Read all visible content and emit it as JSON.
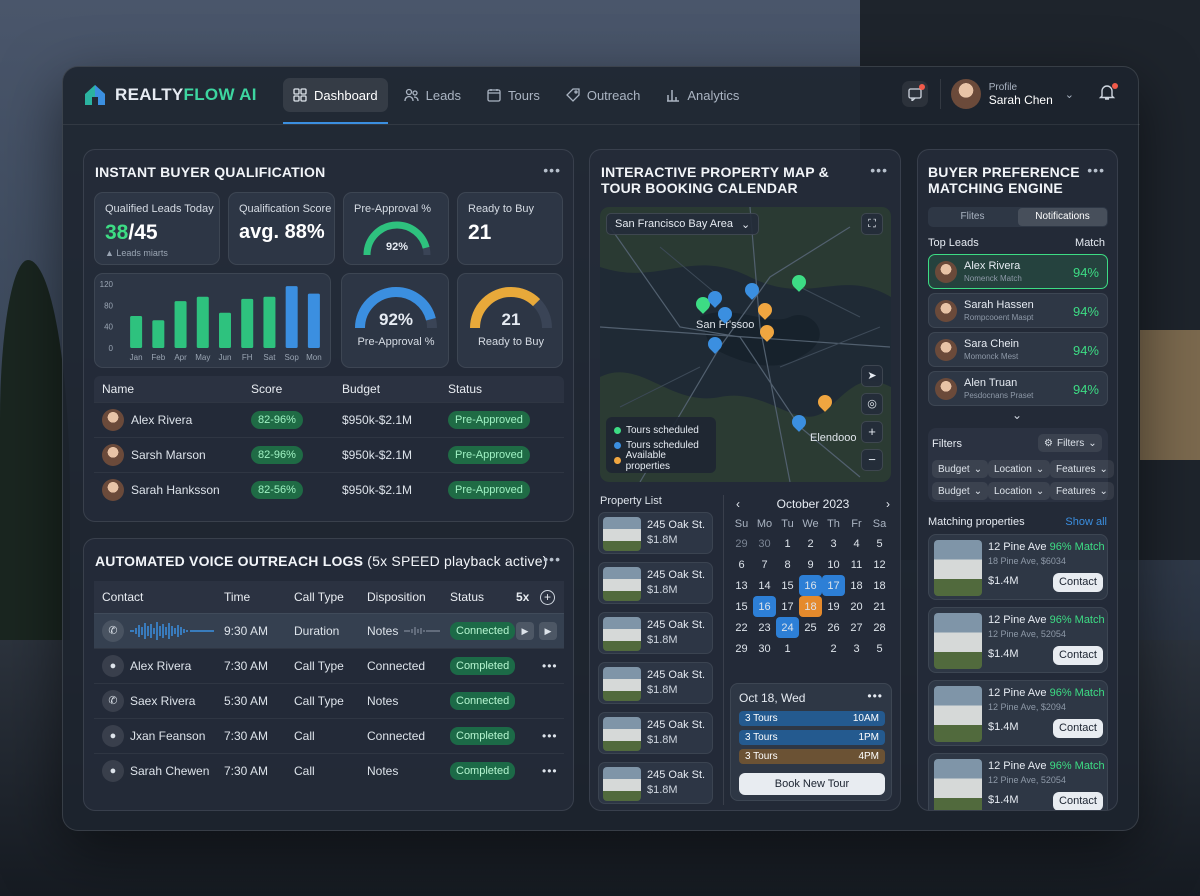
{
  "app": {
    "brand_a": "REALTY",
    "brand_b": "FLOW AI",
    "accent": "#3ddc84"
  },
  "nav": [
    {
      "label": "Dashboard",
      "icon": "grid-icon"
    },
    {
      "label": "Leads",
      "icon": "users-icon"
    },
    {
      "label": "Tours",
      "icon": "calendar-icon"
    },
    {
      "label": "Outreach",
      "icon": "tag-icon"
    },
    {
      "label": "Analytics",
      "icon": "bar-chart-icon"
    }
  ],
  "profile": {
    "label": "Profile",
    "name": "Sarah Chen"
  },
  "qual": {
    "title": "INSTANT BUYER QUALIFICATION",
    "kpi1_label": "Qualified Leads Today",
    "kpi1_a": "38",
    "kpi1_b": "/45",
    "kpi1_sub": "▲ Leads miarts",
    "kpi2_label": "Qualification Score",
    "kpi2_value": "avg. 88%",
    "kpi3_label": "Pre-Approval %",
    "kpi3_value": "92%",
    "kpi3_fraction": 0.92,
    "kpi4_label": "Ready to Buy",
    "kpi4_value": "21",
    "gauge1_value": "92%",
    "gauge1_label": "Pre-Approval %",
    "gauge1_fraction": 0.92,
    "gauge2_value": "21",
    "gauge2_label": "Ready to Buy",
    "gauge2_fraction": 0.75,
    "table_headers": [
      "Name",
      "Score",
      "Budget",
      "Status"
    ],
    "rows": [
      {
        "name": "Alex Rivera",
        "score": "82-96%",
        "budget": "$950k-$2.1M",
        "status": "Pre-Approved"
      },
      {
        "name": "Sarsh Marson",
        "score": "82-96%",
        "budget": "$950k-$2.1M",
        "status": "Pre-Approved"
      },
      {
        "name": "Sarah Hanksson",
        "score": "82-56%",
        "budget": "$950k-$2.1M",
        "status": "Pre-Approved"
      }
    ]
  },
  "chart_data": {
    "type": "bar",
    "categories": [
      "Jan",
      "Feb",
      "Apr",
      "May",
      "Jun",
      "FH",
      "Sat",
      "Sop",
      "Mon"
    ],
    "values": [
      60,
      52,
      88,
      96,
      66,
      92,
      96,
      116,
      102
    ],
    "ylim": [
      0,
      120
    ],
    "yticks": [
      "120",
      "80",
      "40",
      "0"
    ],
    "highlight": [
      "Sop",
      "Mon"
    ]
  },
  "voice": {
    "title": "AUTOMATED VOICE OUTREACH LOGS",
    "title_suffix": "(5x SPEED playback active)",
    "headers": [
      "Contact",
      "Time",
      "Call Type",
      "Disposition",
      "Status",
      "5x"
    ],
    "rows": [
      {
        "contact": "",
        "time": "9:30 AM",
        "type": "Duration",
        "disp": "Notes",
        "status": "Connected"
      },
      {
        "contact": "Alex Rivera",
        "time": "7:30 AM",
        "type": "Call Type",
        "disp": "Connected",
        "status": "Completed"
      },
      {
        "contact": "Saex Rivera",
        "time": "5:30 AM",
        "type": "Call Type",
        "disp": "Notes",
        "status": "Connected"
      },
      {
        "contact": "Jxan Feanson",
        "time": "7:30 AM",
        "type": "Call",
        "disp": "Connected",
        "status": "Completed"
      },
      {
        "contact": "Sarah Chewen",
        "time": "7:30 AM",
        "type": "Call",
        "disp": "Notes",
        "status": "Completed"
      }
    ]
  },
  "map": {
    "title_1": "INTERACTIVE PROPERTY MAP &",
    "title_2": "TOUR BOOKING CALENDAR",
    "area": "San Francisco Bay Area",
    "city1": "San Fr'ssoo",
    "city2": "Elendooo",
    "legend": [
      {
        "label": "Tours scheduled",
        "color": "#3ddc84"
      },
      {
        "label": "Tours scheduled",
        "color": "#3b8fe0"
      },
      {
        "label": "Available properties",
        "color": "#f0a640"
      }
    ]
  },
  "plist": {
    "title": "Property List",
    "items": [
      {
        "addr": "245 Oak St.",
        "price": "$1.8M"
      },
      {
        "addr": "245 Oak St.",
        "price": "$1.8M"
      },
      {
        "addr": "245 Oak St.",
        "price": "$1.8M"
      },
      {
        "addr": "245 Oak St.",
        "price": "$1.8M"
      },
      {
        "addr": "245 Oak St.",
        "price": "$1.8M"
      },
      {
        "addr": "245 Oak St.",
        "price": "$1.8M"
      }
    ]
  },
  "calendar": {
    "month": "October 2023",
    "days": [
      "Su",
      "Mo",
      "Tu",
      "We",
      "Th",
      "Fr",
      "Sa"
    ],
    "weeks": [
      [
        "29",
        "30",
        "1",
        "2",
        "3",
        "4",
        "5"
      ],
      [
        "6",
        "7",
        "8",
        "9",
        "10",
        "11",
        "12"
      ],
      [
        "13",
        "14",
        "15",
        "16",
        "17",
        "18",
        "18"
      ],
      [
        "15",
        "16",
        "17",
        "18",
        "19",
        "20",
        "21"
      ],
      [
        "22",
        "23",
        "24",
        "25",
        "26",
        "27",
        "28"
      ],
      [
        "29",
        "30",
        "1",
        "",
        "2",
        "3",
        "5"
      ]
    ]
  },
  "day": {
    "label": "Oct 18, Wed",
    "tours": [
      {
        "l": "3 Tours",
        "t": "10AM"
      },
      {
        "l": "3 Tours",
        "t": "1PM"
      },
      {
        "l": "3 Tours",
        "t": "4PM"
      }
    ],
    "book": "Book New Tour"
  },
  "match": {
    "title_1": "BUYER PREFERENCE",
    "title_2": "MATCHING ENGINE",
    "tab1": "Flites",
    "tab2": "Notifications",
    "top_leads": "Top Leads",
    "match_col": "Match",
    "leads": [
      {
        "name": "Alex Rivera",
        "sub": "Nomenck Match",
        "pct": "94%"
      },
      {
        "name": "Sarah Hassen",
        "sub": "Rompcooent Maspt",
        "pct": "94%"
      },
      {
        "name": "Sara Chein",
        "sub": "Momonck Mest",
        "pct": "94%"
      },
      {
        "name": "Alen Truan",
        "sub": "Pesdocnans Praset",
        "pct": "94%"
      }
    ],
    "filters": "Filters",
    "filters_btn": "Filters",
    "dd": [
      "Budget",
      "Location",
      "Features",
      "Budget",
      "Location",
      "Features"
    ],
    "mp_title": "Matching properties",
    "show_all": "Show all",
    "props": [
      {
        "name": "12 Pine Ave",
        "match": "96% Match",
        "addr": "18 Pine Ave, $6034",
        "price": "$1.4M",
        "btn": "Contact"
      },
      {
        "name": "12 Pine Ave",
        "match": "96% Match",
        "addr": "12 Pine Ave, 52054",
        "price": "$1.4M",
        "btn": "Contact"
      },
      {
        "name": "12 Pine Ave",
        "match": "96% Match",
        "addr": "12 Pine Ave, $2094",
        "price": "$1.4M",
        "btn": "Contact"
      },
      {
        "name": "12 Pine Ave",
        "match": "96% Match",
        "addr": "12 Pine Ave, 52054",
        "price": "$1.4M",
        "btn": "Contact"
      }
    ]
  }
}
